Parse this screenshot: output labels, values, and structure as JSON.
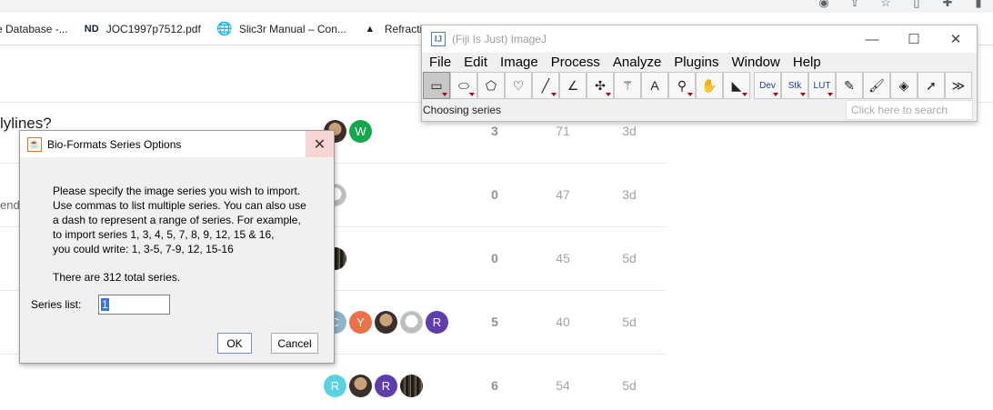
{
  "bookmarks": [
    {
      "label": "e Database -...",
      "icon": "page-icon"
    },
    {
      "label": "JOC1997p7512.pdf",
      "icon": "notre-dame-icon"
    },
    {
      "label": "Slic3r Manual – Con...",
      "icon": "globe-icon"
    },
    {
      "label": "Refractive",
      "icon": "triangle-logo-icon"
    }
  ],
  "forum": {
    "title_fragment": "lylines?",
    "subtitle_fragment": "ende",
    "rows": [
      {
        "avatars": [
          {
            "type": "photo"
          },
          {
            "type": "letter",
            "letter": "W",
            "color": "#12a84b"
          }
        ],
        "replies": "3",
        "views": "71",
        "activity": "3d"
      },
      {
        "avatars": [
          {
            "type": "sketch"
          }
        ],
        "replies": "0",
        "views": "47",
        "activity": "3d"
      },
      {
        "avatars": [
          {
            "type": "dark"
          }
        ],
        "replies": "0",
        "views": "45",
        "activity": "5d"
      },
      {
        "avatars": [
          {
            "type": "letter",
            "letter": "C",
            "color": "#8fb3c9"
          },
          {
            "type": "letter",
            "letter": "Y",
            "color": "#e8734a"
          },
          {
            "type": "photo"
          },
          {
            "type": "sketch"
          },
          {
            "type": "letter",
            "letter": "R",
            "color": "#5f3dab"
          }
        ],
        "replies": "5",
        "views": "40",
        "activity": "5d"
      },
      {
        "avatars": [
          {
            "type": "letter",
            "letter": "R",
            "color": "#59d3e0"
          },
          {
            "type": "photo"
          },
          {
            "type": "letter",
            "letter": "R",
            "color": "#5f3dab"
          },
          {
            "type": "dark"
          }
        ],
        "replies": "6",
        "views": "54",
        "activity": "5d"
      }
    ]
  },
  "imagej": {
    "title": "(Fiji Is Just) ImageJ",
    "menu": [
      "File",
      "Edit",
      "Image",
      "Process",
      "Analyze",
      "Plugins",
      "Window",
      "Help"
    ],
    "tools_left": [
      {
        "name": "rectangle-tool",
        "glyph": "▭",
        "selected": true,
        "tri": true
      },
      {
        "name": "oval-tool",
        "glyph": "⬭",
        "tri": true
      },
      {
        "name": "polygon-tool",
        "glyph": "⬠",
        "tri": false
      },
      {
        "name": "freehand-tool",
        "glyph": "♡",
        "tri": false
      },
      {
        "name": "line-tool",
        "glyph": "╱",
        "tri": true
      },
      {
        "name": "angle-tool",
        "glyph": "∠",
        "tri": false
      },
      {
        "name": "point-tool",
        "glyph": "✣",
        "tri": true
      },
      {
        "name": "wand-tool",
        "glyph": "⚚",
        "tri": false
      },
      {
        "name": "text-tool",
        "glyph": "A",
        "tri": false
      },
      {
        "name": "zoom-tool",
        "glyph": "⚲",
        "tri": true
      },
      {
        "name": "hand-tool",
        "glyph": "✋",
        "tri": false
      },
      {
        "name": "dropper-tool",
        "glyph": "◣",
        "tri": true
      }
    ],
    "tools_right": [
      {
        "name": "dev-tool",
        "glyph": "Dev",
        "small": true,
        "tri": true
      },
      {
        "name": "stk-tool",
        "glyph": "Stk",
        "small": true,
        "tri": true
      },
      {
        "name": "lut-tool",
        "glyph": "LUT",
        "small": true,
        "tri": true
      },
      {
        "name": "pencil-tool",
        "glyph": "✎",
        "tri": false
      },
      {
        "name": "brush-tool",
        "glyph": "🖌",
        "tri": false
      },
      {
        "name": "flood-fill-tool",
        "glyph": "◈",
        "tri": false
      },
      {
        "name": "arrow-tool",
        "glyph": "➚",
        "tri": false
      },
      {
        "name": "more-tools",
        "glyph": "≫",
        "tri": false
      }
    ],
    "status": "Choosing series",
    "search_placeholder": "Click here to search"
  },
  "dialog": {
    "title": "Bio-Formats Series Options",
    "instructions": "Please specify the image series you wish to import.\nUse commas to list multiple series. You can also use\na dash to represent a range of series. For example,\nto import series 1, 3, 4, 5, 7, 8, 9, 12, 15 & 16,\nyou could write: 1, 3-5, 7-9, 12, 15-16",
    "total": "There are 312 total series.",
    "series_label": "Series list:",
    "series_value": "1",
    "ok_label": "OK",
    "cancel_label": "Cancel"
  }
}
